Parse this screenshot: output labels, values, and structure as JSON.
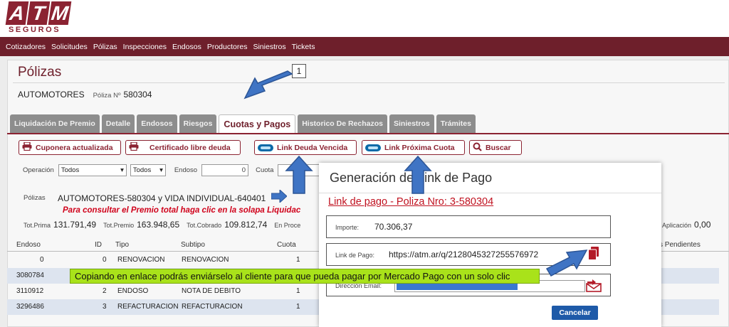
{
  "logo": {
    "letters": [
      "A",
      "T",
      "M"
    ],
    "subtitle": "SEGUROS"
  },
  "nav": [
    "Cotizadores",
    "Solicitudes",
    "Pólizas",
    "Inspecciones",
    "Endosos",
    "Productores",
    "Siniestros",
    "Tickets"
  ],
  "page": {
    "title": "Pólizas",
    "step": "1",
    "policy_type": "AUTOMOTORES",
    "policy_label": "Póliza Nº",
    "policy_number": "580304"
  },
  "tabs": [
    {
      "label": "Liquidación De Premio",
      "active": false
    },
    {
      "label": "Detalle",
      "active": false
    },
    {
      "label": "Endosos",
      "active": false
    },
    {
      "label": "Riesgos",
      "active": false
    },
    {
      "label": "Cuotas y Pagos",
      "active": true
    },
    {
      "label": "Historico De Rechazos",
      "active": false
    },
    {
      "label": "Siniestros",
      "active": false
    },
    {
      "label": "Trámites",
      "active": false
    }
  ],
  "actions": {
    "cuponera": "Cuponera actualizada",
    "certificado": "Certificado libre deuda",
    "link_deuda": "Link Deuda Vencida",
    "link_proxima": "Link Próxima Cuota",
    "buscar": "Buscar"
  },
  "filters": {
    "operacion_label": "Operación",
    "operacion_value": "Todos",
    "second_value": "Todos",
    "endoso_label": "Endoso",
    "endoso_value": "0",
    "cuota_label": "Cuota"
  },
  "polizas": {
    "label": "Pólizas",
    "value": "AUTOMOTORES-580304 y VIDA INDIVIDUAL-640401"
  },
  "warning": "Para consultar el Premio total haga clic en la solapa Liquidac",
  "totals": {
    "prima_label": "Tot.Prima",
    "prima_value": "131.791,49",
    "premio_label": "Tot.Premio",
    "premio_value": "163.948,65",
    "cobrado_label": "Tot.Cobrado",
    "cobrado_value": "109.812,74",
    "proceso_label": "En Proce",
    "aplicacion_label": "Aplicación",
    "aplicacion_value": "0,00"
  },
  "table": {
    "headers": {
      "endoso": "Endoso",
      "id": "ID",
      "tipo": "Tipo",
      "subtipo": "Subtipo",
      "cuota": "Cuota",
      "pendientes": "s Pendientes"
    },
    "rows": [
      {
        "endoso": "0",
        "id": "0",
        "tipo": "RENOVACION",
        "subtipo": "RENOVACION",
        "cuota": "1"
      },
      {
        "endoso": "3080784",
        "id": "",
        "tipo": "",
        "subtipo": "",
        "cuota": ""
      },
      {
        "endoso": "3110912",
        "id": "2",
        "tipo": "ENDOSO",
        "subtipo": "NOTA DE DEBITO",
        "cuota": "1"
      },
      {
        "endoso": "3296486",
        "id": "3",
        "tipo": "REFACTURACION",
        "subtipo": "REFACTURACION",
        "cuota": "1"
      }
    ]
  },
  "modal": {
    "title": "Generación de Link de Pago",
    "subtitle": "Link de pago - Poliza Nro: 3-580304",
    "importe_label": "Importe:",
    "importe_value": "70.306,37",
    "link_label": "Link de Pago:",
    "link_value": "https://atm.ar/q/2128045327255576972",
    "email_label": "Dirección Email:",
    "cancel": "Cancelar"
  },
  "callout": "Copiando en enlace podrás enviárselo al cliente para que pueda pagar por Mercado Pago con un solo clic",
  "colors": {
    "brand": "#8b2332",
    "nav": "#6e1f2b",
    "callout": "#a9e21a",
    "arrow": "#3f74c4",
    "cancel": "#1e5aa8"
  }
}
